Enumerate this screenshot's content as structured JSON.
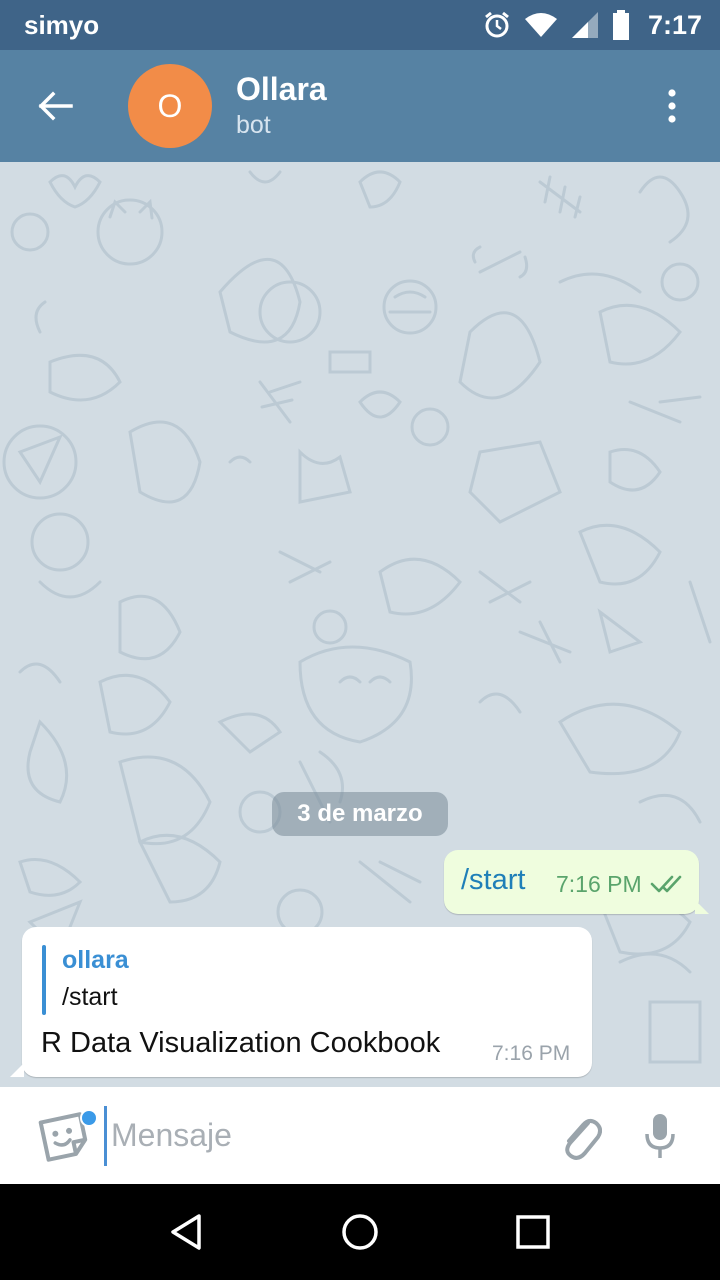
{
  "status_bar": {
    "carrier": "simyo",
    "time": "7:17",
    "icons": [
      "alarm-icon",
      "wifi-icon",
      "signal-icon",
      "battery-icon"
    ]
  },
  "header": {
    "avatar_letter": "O",
    "title": "Ollara",
    "subtitle": "bot",
    "avatar_color": "#f28c48",
    "bar_color": "#5682a3"
  },
  "chat": {
    "date_separator": "3 de marzo",
    "messages": [
      {
        "direction": "outgoing",
        "text": "/start",
        "time": "7:16 PM",
        "status": "read"
      },
      {
        "direction": "incoming",
        "reply_to": {
          "name": "ollara",
          "text": "/start"
        },
        "text": "R Data Visualization Cookbook",
        "time": "7:16 PM"
      }
    ]
  },
  "composer": {
    "placeholder": "Mensaje"
  }
}
